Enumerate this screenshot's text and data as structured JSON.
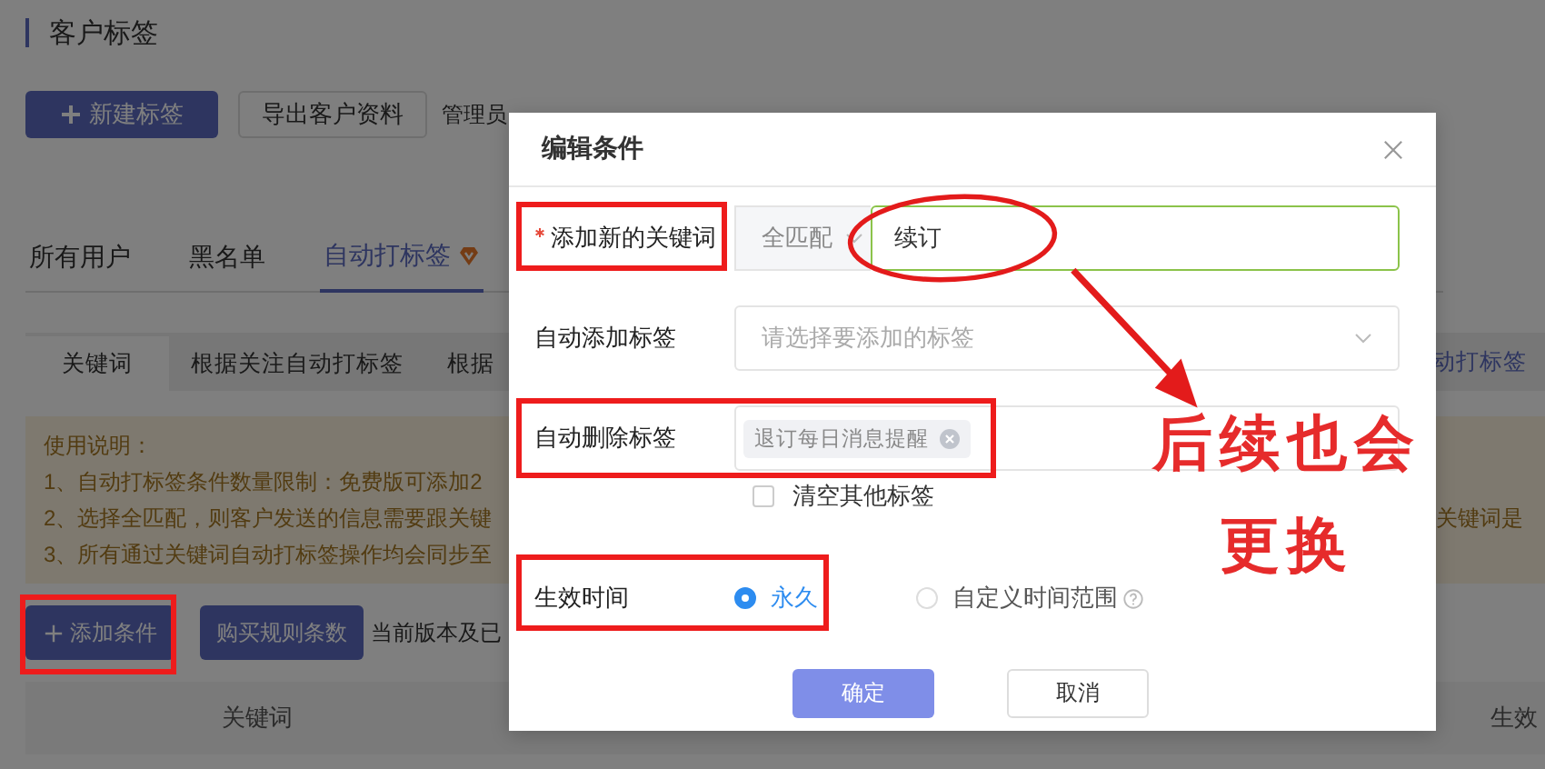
{
  "page": {
    "title": "客户标签",
    "actions": [
      {
        "label": "新建标签",
        "kind": "primary"
      },
      {
        "label": "导出客户资料",
        "kind": "default"
      }
    ],
    "description": "管理员",
    "tabs": [
      {
        "label": "所有用户",
        "selected": false,
        "premium": false
      },
      {
        "label": "黑名单",
        "selected": false,
        "premium": false
      },
      {
        "label": "自动打标签",
        "selected": true,
        "premium": true
      }
    ],
    "subtabs": [
      {
        "label": "关键词",
        "selected": true
      },
      {
        "label": "根据关注自动打标签",
        "selected": false
      },
      {
        "label": "根据",
        "selected": false
      }
    ],
    "side_link": "动打标签",
    "notice": {
      "title": "使用说明：",
      "lines": [
        "1、自动打标签条件数量限制：免费版可添加2",
        "2、选择全匹配，则客户发送的信息需要跟关键",
        "3、所有通过关键词自动打标签操作均会同步至"
      ],
      "tail": "关键词是"
    },
    "toolbar": {
      "add_button": {
        "label": "添加条件",
        "annotated": true
      },
      "buy_button": "购买规则条数",
      "version_text": "当前版本及已"
    },
    "table": {
      "columns": [
        "关键词",
        "生效"
      ]
    }
  },
  "modal": {
    "title": "编辑条件",
    "fields": [
      {
        "kind": "keyword",
        "label": "添加新的关键词",
        "required": true,
        "annotated": true,
        "match": "全匹配",
        "value": "续订",
        "circled": true
      },
      {
        "kind": "select",
        "label": "自动添加标签",
        "required": false,
        "annotated": false,
        "placeholder": "请选择要添加的标签"
      },
      {
        "kind": "tags",
        "label": "自动删除标签",
        "required": false,
        "annotated": true,
        "tags": [
          "退订每日消息提醒"
        ],
        "checkbox": {
          "label": "清空其他标签",
          "checked": false
        }
      },
      {
        "kind": "radio",
        "label": "生效时间",
        "required": false,
        "annotated": true,
        "options": [
          {
            "label": "永久",
            "selected": true,
            "help": false
          },
          {
            "label": "自定义时间范围",
            "selected": false,
            "help": true
          }
        ]
      }
    ],
    "confirm": "确定",
    "cancel": "取消"
  },
  "annotation": {
    "lines": [
      "后续也会",
      "更换"
    ]
  }
}
